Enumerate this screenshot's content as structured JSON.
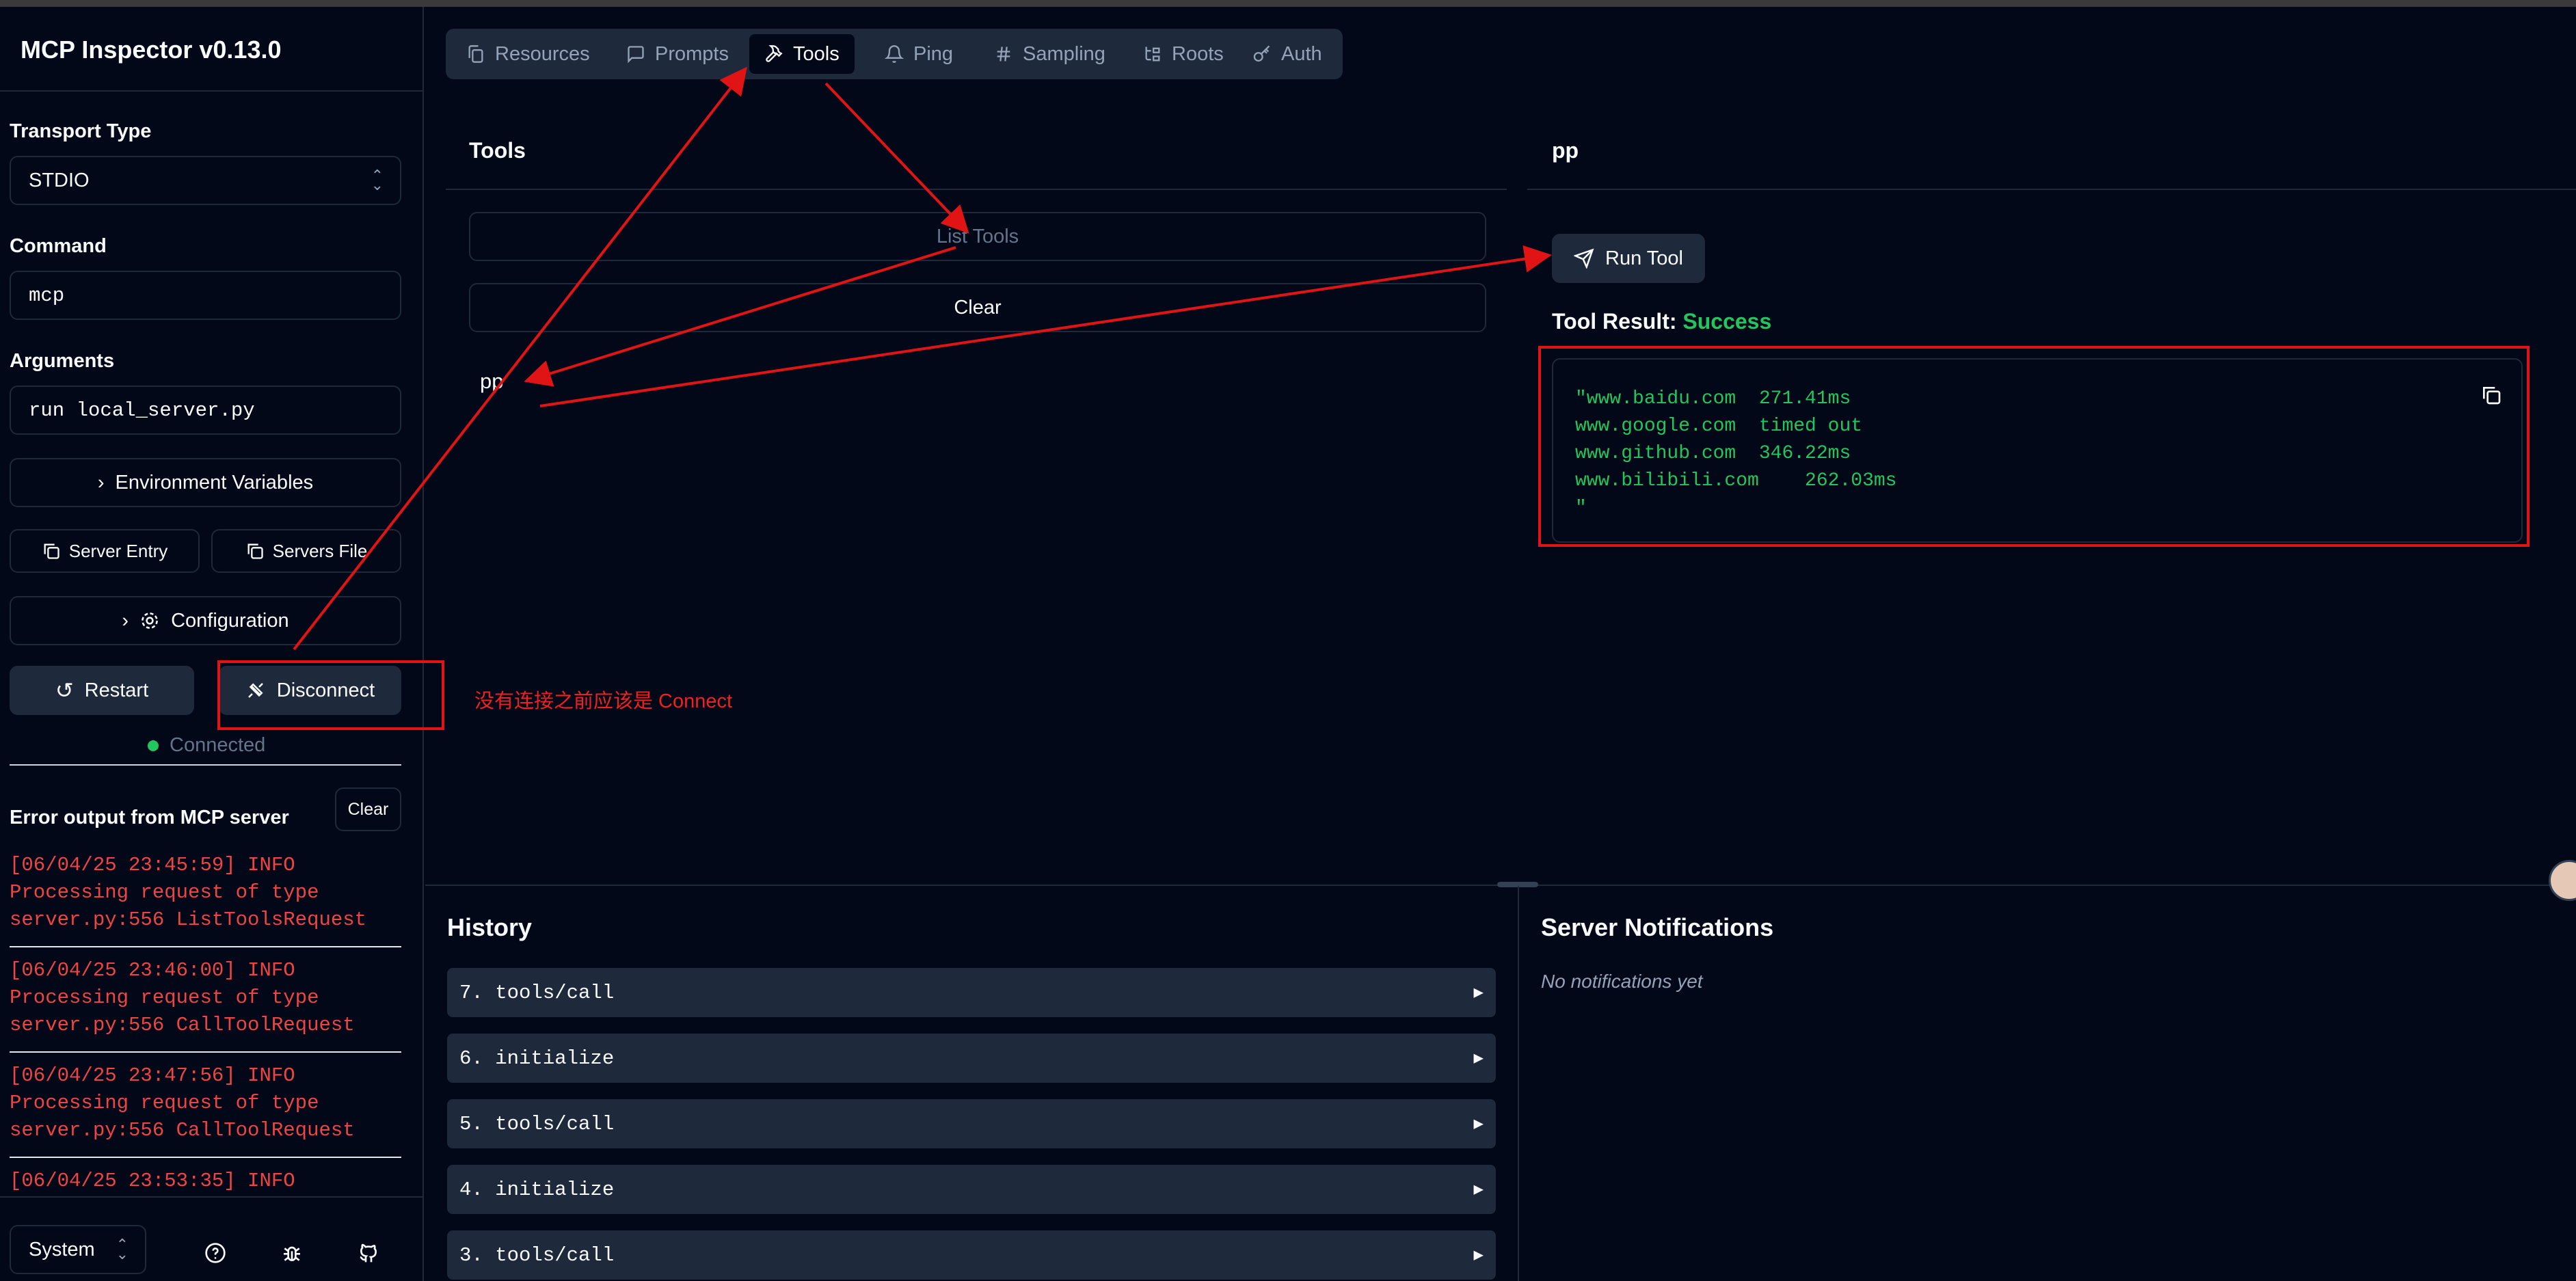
{
  "app": {
    "title": "MCP Inspector v0.13.0"
  },
  "sidebar": {
    "transport_label": "Transport Type",
    "transport_value": "STDIO",
    "command_label": "Command",
    "command_value": "mcp",
    "arguments_label": "Arguments",
    "arguments_value": "run local_server.py",
    "env_button": "Environment Variables",
    "server_entry_button": "Server Entry",
    "servers_file_button": "Servers File",
    "config_button": "Configuration",
    "restart_button": "Restart",
    "disconnect_button": "Disconnect",
    "status": "Connected",
    "error_title": "Error output from MCP server",
    "clear_button": "Clear",
    "logs": [
      {
        "line1": "[06/04/25 23:45:59] INFO",
        "line2": "Processing request of type",
        "line3": "server.py:556 ListToolsRequest"
      },
      {
        "line1": "[06/04/25 23:46:00] INFO",
        "line2": "Processing request of type",
        "line3": "server.py:556 CallToolRequest"
      },
      {
        "line1": "[06/04/25 23:47:56] INFO",
        "line2": "Processing request of type",
        "line3": "server.py:556 CallToolRequest"
      },
      {
        "line1": "[06/04/25 23:53:35] INFO"
      }
    ],
    "theme_select": "System"
  },
  "tabs": [
    "Resources",
    "Prompts",
    "Tools",
    "Ping",
    "Sampling",
    "Roots",
    "Auth"
  ],
  "tools_panel": {
    "title": "Tools",
    "list_button": "List Tools",
    "clear_button": "Clear",
    "items": [
      "pp"
    ]
  },
  "tool_detail": {
    "title": "pp",
    "run_button": "Run Tool",
    "result_label": "Tool Result:",
    "result_status": "Success",
    "result_lines": [
      "\"www.baidu.com  271.41ms",
      "www.google.com  timed out",
      "www.github.com  346.22ms",
      "www.bilibili.com    262.03ms",
      "\""
    ]
  },
  "history": {
    "title": "History",
    "items": [
      "7. tools/call",
      "6. initialize",
      "5. tools/call",
      "4. initialize",
      "3. tools/call"
    ]
  },
  "notifications": {
    "title": "Server Notifications",
    "empty": "No notifications yet"
  },
  "annotation": {
    "note": "没有连接之前应该是 Connect"
  },
  "colors": {
    "background": "#020817",
    "surface": "#1e293b",
    "success": "#22c55e",
    "error": "#ef4444",
    "annotation": "#e01414"
  }
}
